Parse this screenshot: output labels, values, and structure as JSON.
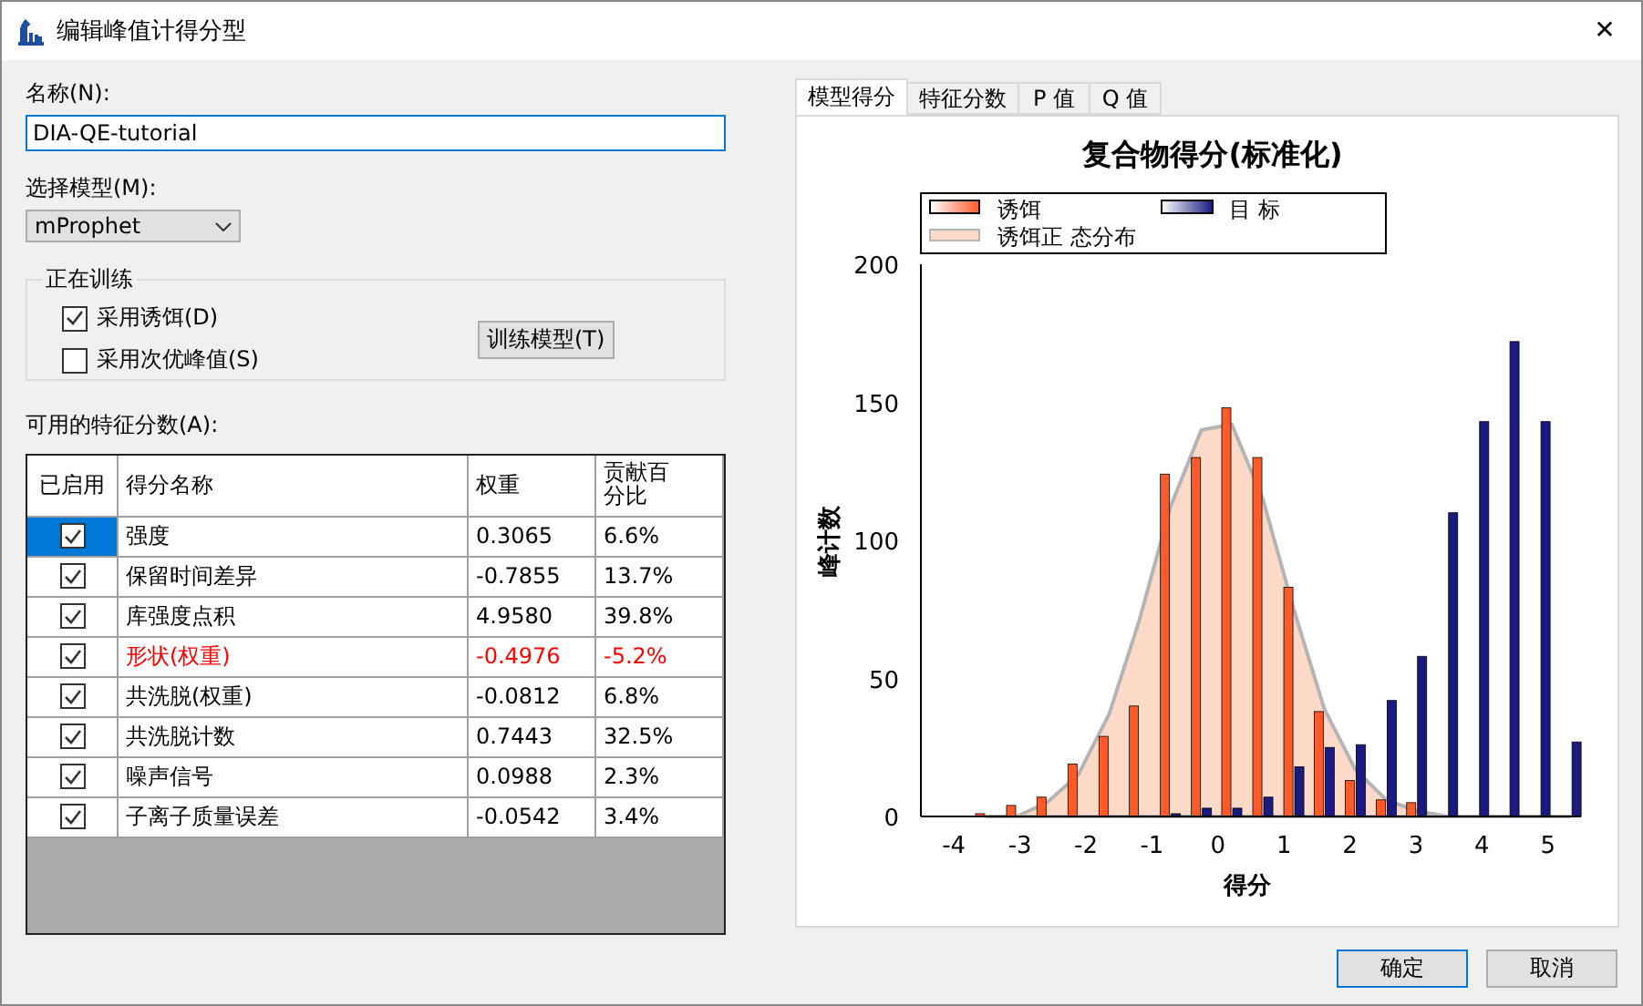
{
  "window": {
    "title": "编辑峰值计得分型",
    "close": "✕"
  },
  "name_field": {
    "label": "名称(N):",
    "value": "DIA-QE-tutorial"
  },
  "model_select": {
    "label": "选择模型(M):",
    "value": "mProphet"
  },
  "training": {
    "title": "正在训练",
    "options": [
      {
        "label": "采用诱饵(D)",
        "checked": true
      },
      {
        "label": "采用次优峰值(S)",
        "checked": false
      }
    ],
    "train_button": "训练模型(T)"
  },
  "features": {
    "label": "可用的特征分数(A):",
    "columns": [
      "已启用",
      "得分名称",
      "权重",
      "贡献百分比"
    ],
    "rows": [
      {
        "enabled": true,
        "selected": true,
        "name": "强度",
        "weight": "0.3065",
        "percent": "6.6%",
        "color": "#000000"
      },
      {
        "enabled": true,
        "selected": false,
        "name": "保留时间差异",
        "weight": "-0.7855",
        "percent": "13.7%",
        "color": "#000000"
      },
      {
        "enabled": true,
        "selected": false,
        "name": "库强度点积",
        "weight": "4.9580",
        "percent": "39.8%",
        "color": "#000000"
      },
      {
        "enabled": true,
        "selected": false,
        "name": "形状(权重)",
        "weight": "-0.4976",
        "percent": "-5.2%",
        "color": "#ff0000"
      },
      {
        "enabled": true,
        "selected": false,
        "name": "共洗脱(权重)",
        "weight": "-0.0812",
        "percent": "6.8%",
        "color": "#000000"
      },
      {
        "enabled": true,
        "selected": false,
        "name": "共洗脱计数",
        "weight": "0.7443",
        "percent": "32.5%",
        "color": "#000000"
      },
      {
        "enabled": true,
        "selected": false,
        "name": "噪声信号",
        "weight": "0.0988",
        "percent": "2.3%",
        "color": "#000000"
      },
      {
        "enabled": true,
        "selected": false,
        "name": "子离子质量误差",
        "weight": "-0.0542",
        "percent": "3.4%",
        "color": "#000000"
      }
    ]
  },
  "tabs": [
    {
      "label": "模型得分",
      "selected": true
    },
    {
      "label": "特征分数",
      "selected": false
    },
    {
      "label": "P 值",
      "selected": false
    },
    {
      "label": "Q 值",
      "selected": false
    }
  ],
  "chart": {
    "chart_data": {
      "type": "bar",
      "title": "复合物得分(标准化)",
      "xlabel": "得分",
      "ylabel": "峰计数",
      "x": [
        -3.52,
        -3.05,
        -2.59,
        -2.12,
        -1.65,
        -1.19,
        -0.72,
        -0.25,
        0.21,
        0.68,
        1.15,
        1.61,
        2.08,
        2.55,
        3.01,
        3.48,
        3.95,
        4.41,
        4.88,
        5.35
      ],
      "series": [
        {
          "name": "诱饵",
          "color": "#ff5a2a",
          "values": [
            1,
            4,
            7,
            19,
            29,
            40,
            124,
            130,
            148,
            130,
            83,
            38,
            13,
            6,
            5,
            0,
            0,
            0,
            0,
            0
          ]
        },
        {
          "name": "目 标",
          "color": "#1a1a80",
          "values": [
            0,
            0,
            0,
            0,
            0,
            0,
            1,
            3,
            3,
            7,
            18,
            25,
            26,
            42,
            58,
            110,
            143,
            172,
            143,
            27
          ]
        },
        {
          "name": "诱饵正 态分布",
          "type": "area",
          "color": "#b4b4b4",
          "values": [
            0,
            0,
            5,
            15,
            37,
            71,
            112,
            140,
            142,
            115,
            75,
            39,
            17,
            6,
            2,
            0,
            0,
            0,
            0,
            0
          ]
        }
      ],
      "xlim": [
        -4.5,
        5.5
      ],
      "ylim": [
        0,
        200
      ],
      "xticks": [
        -4,
        -3,
        -2,
        -1,
        0,
        1,
        2,
        3,
        4,
        5
      ],
      "yticks": [
        0,
        50,
        100,
        150,
        200
      ],
      "legend": true
    }
  },
  "buttons": [
    "确定",
    "取消"
  ]
}
